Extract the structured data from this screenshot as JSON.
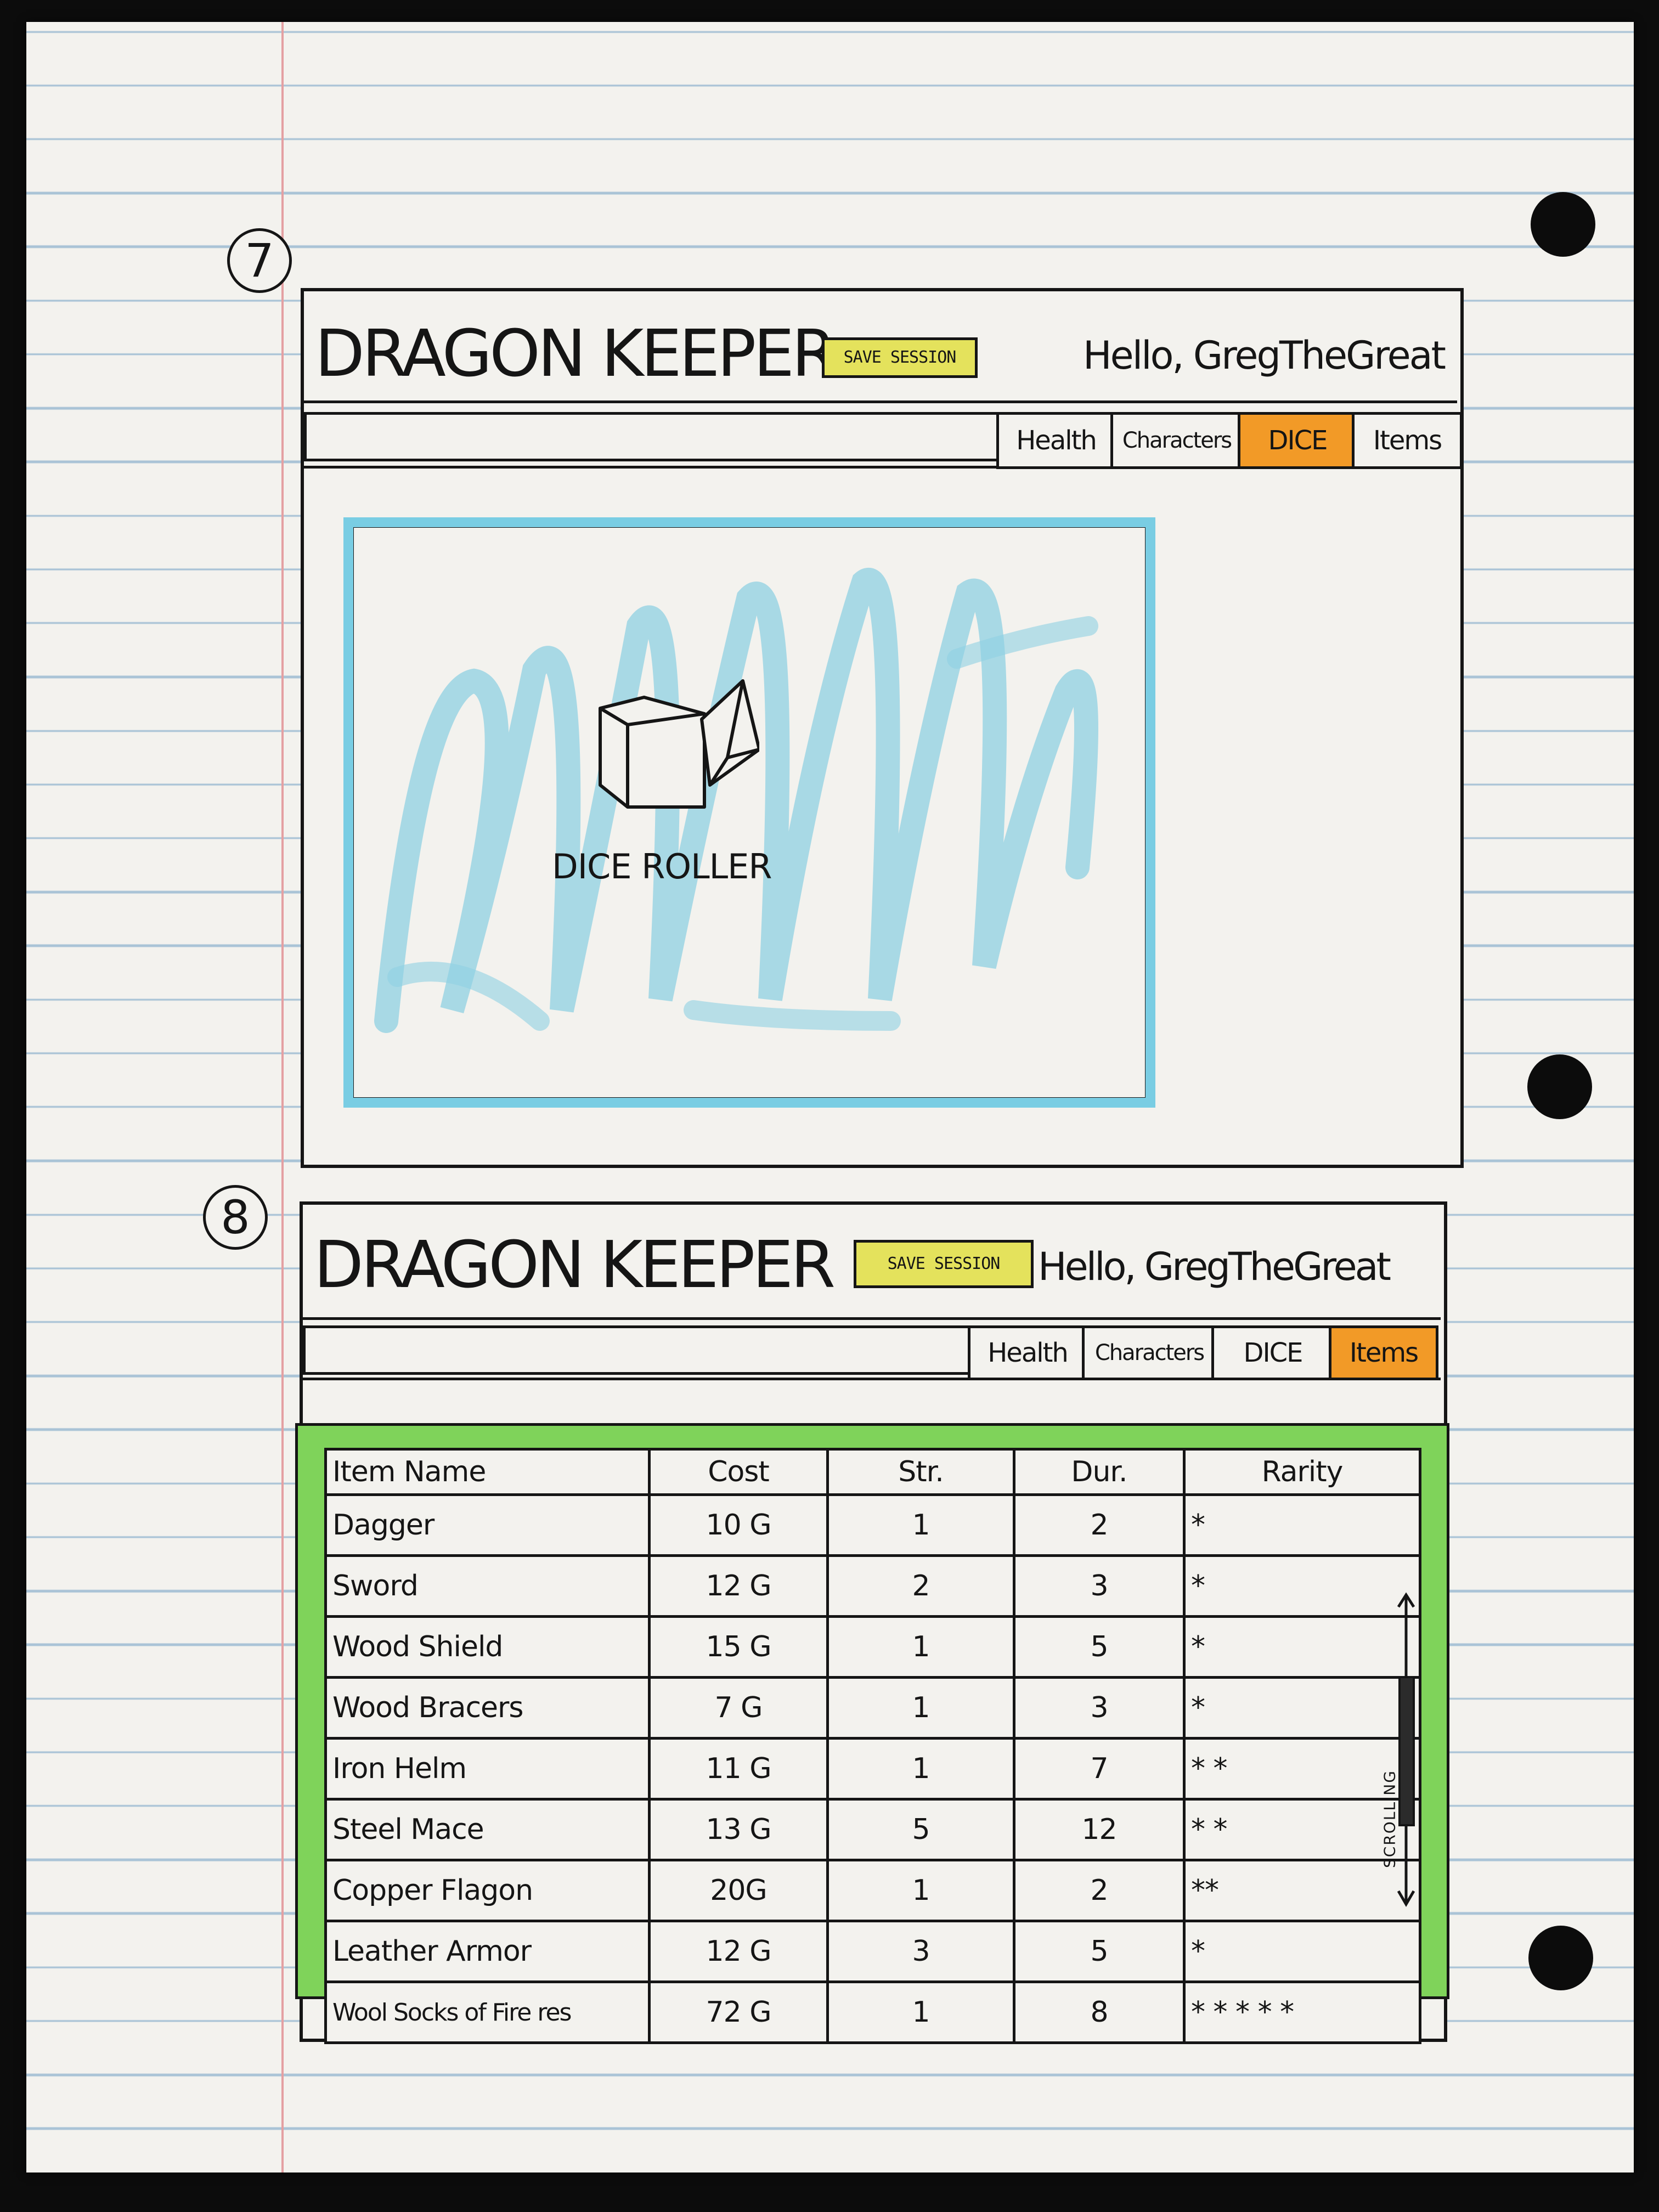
{
  "sketch7": {
    "number": "7",
    "app_title": "DRAGON KEEPER",
    "save_button": "SAVE SESSION",
    "greeting": "Hello, GregTheGreat",
    "tabs": [
      {
        "label": "Health",
        "active": false
      },
      {
        "label": "Characters",
        "active": false
      },
      {
        "label": "DICE",
        "active": true
      },
      {
        "label": "Items",
        "active": false
      }
    ],
    "panel_label": "DICE ROLLER",
    "icon": "dice-icon",
    "colors": {
      "panel_border": "#79cde3",
      "active_tab": "#f29a27",
      "save_button": "#e4e25c"
    }
  },
  "sketch8": {
    "number": "8",
    "app_title": "DRAGON KEEPER",
    "save_button": "SAVE SESSION",
    "greeting": "Hello, GregTheGreat",
    "tabs": [
      {
        "label": "Health",
        "active": false
      },
      {
        "label": "Characters",
        "active": false
      },
      {
        "label": "DICE",
        "active": false
      },
      {
        "label": "Items",
        "active": true
      }
    ],
    "table": {
      "columns": [
        "Item Name",
        "Cost",
        "Str.",
        "Dur.",
        "Rarity"
      ],
      "rows": [
        [
          "Dagger",
          "10 G",
          "1",
          "2",
          "*"
        ],
        [
          "Sword",
          "12 G",
          "2",
          "3",
          "*"
        ],
        [
          "Wood Shield",
          "15 G",
          "1",
          "5",
          "*"
        ],
        [
          "Wood Bracers",
          "7 G",
          "1",
          "3",
          "*"
        ],
        [
          "Iron Helm",
          "11 G",
          "1",
          "7",
          "* *"
        ],
        [
          "Steel Mace",
          "13 G",
          "5",
          "12",
          "* *"
        ],
        [
          "Copper Flagon",
          "20G",
          "1",
          "2",
          "**"
        ],
        [
          "Leather Armor",
          "12 G",
          "3",
          "5",
          "*"
        ],
        [
          "Wool Socks of Fire res",
          "72 G",
          "1",
          "8",
          "* * * * *"
        ]
      ]
    },
    "scroll_label": "SCROLLING",
    "colors": {
      "panel_fill": "#7fd35a",
      "active_tab": "#f29a27",
      "save_button": "#e4e25c"
    }
  }
}
